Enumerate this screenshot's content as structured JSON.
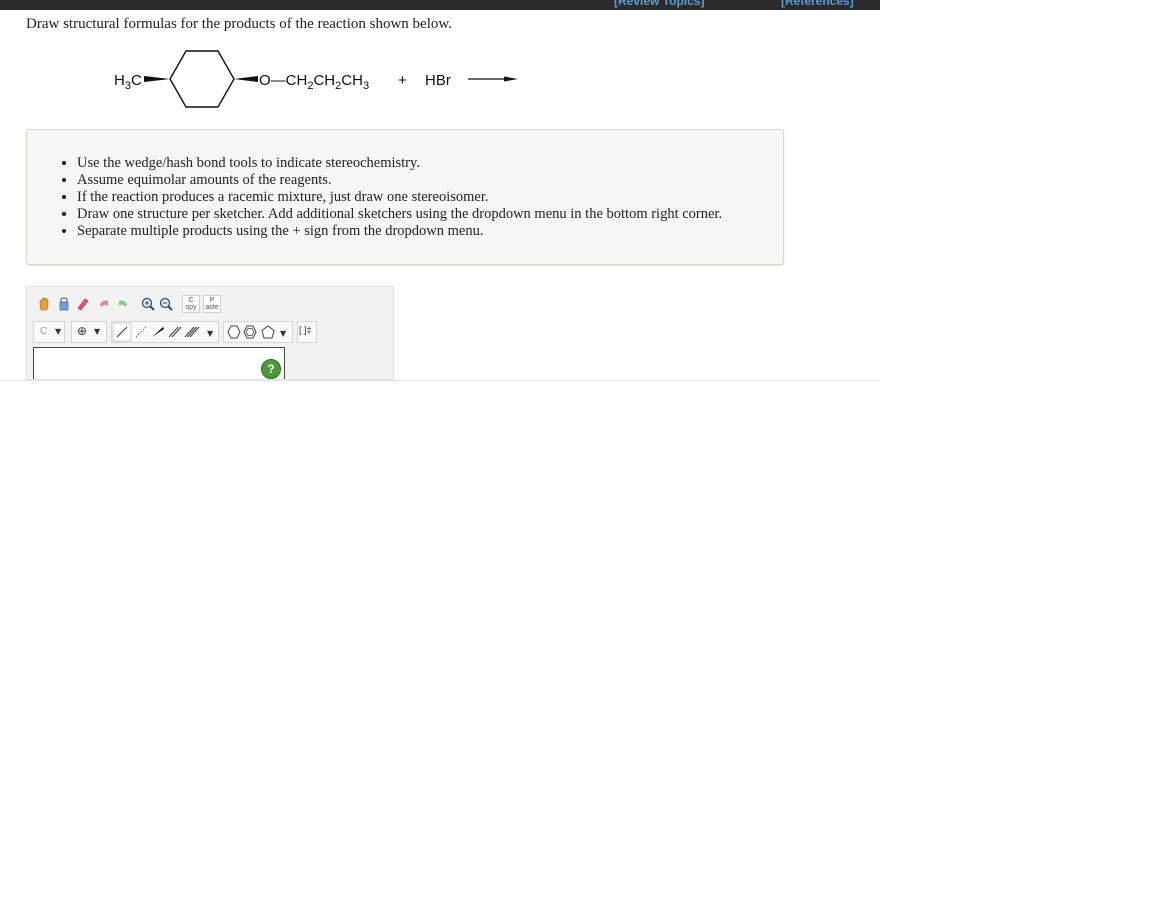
{
  "header": {
    "review_topics": "[Review Topics]",
    "references": "[References]"
  },
  "question": {
    "prompt": "Draw structural formulas for the products of the reaction shown below."
  },
  "reaction": {
    "substituent_left": "H3C",
    "substituent_right": "O—CH2CH2CH3",
    "plus": "+",
    "reagent": "HBr"
  },
  "instructions": [
    "Use the wedge/hash bond tools to indicate stereochemistry.",
    "Assume equimolar amounts of the reagents.",
    "If the reaction produces a racemic mixture, just draw one stereoisomer.",
    "Draw one structure per sketcher. Add additional sketchers using the dropdown menu in the bottom right corner.",
    "Separate multiple products using the + sign from the dropdown menu."
  ],
  "sketcher": {
    "toolbar_row1": [
      "hand-tool",
      "lasso-select",
      "eraser",
      "undo",
      "redo",
      "zoom-in",
      "zoom-out",
      "copy",
      "paste"
    ],
    "copy_label": "C\nopy",
    "paste_label": "P\naste",
    "atom_selector": "C",
    "charge_selector": "⊕",
    "bracket_tool": "[ ]‡",
    "help": "?"
  }
}
